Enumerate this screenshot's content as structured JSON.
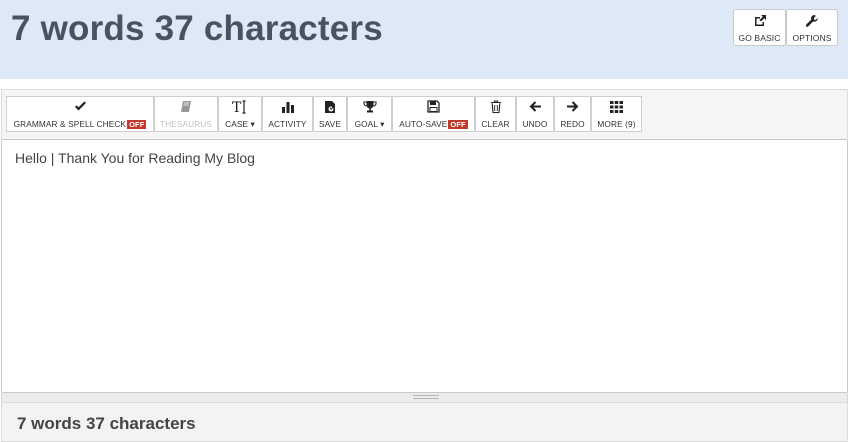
{
  "header": {
    "title": "7 words 37 characters",
    "buttons": {
      "go_basic": "GO BASIC",
      "options": "OPTIONS"
    }
  },
  "toolbar": {
    "grammar": "GRAMMAR & SPELL CHECK",
    "grammar_state": "OFF",
    "thesaurus": "THESAURUS",
    "case": "CASE",
    "activity": "ACTIVITY",
    "save": "SAVE",
    "goal": "GOAL",
    "auto_save": "AUTO-SAVE",
    "auto_save_state": "OFF",
    "clear": "CLEAR",
    "undo": "UNDO",
    "redo": "REDO",
    "more": "MORE (9)"
  },
  "editor": {
    "text": "Hello | Thank You for Reading My Blog"
  },
  "footer": {
    "summary": "7 words 37 characters"
  },
  "colors": {
    "header_bg": "#dde9f7",
    "off_badge": "#c0392b",
    "title": "#4a5261"
  }
}
